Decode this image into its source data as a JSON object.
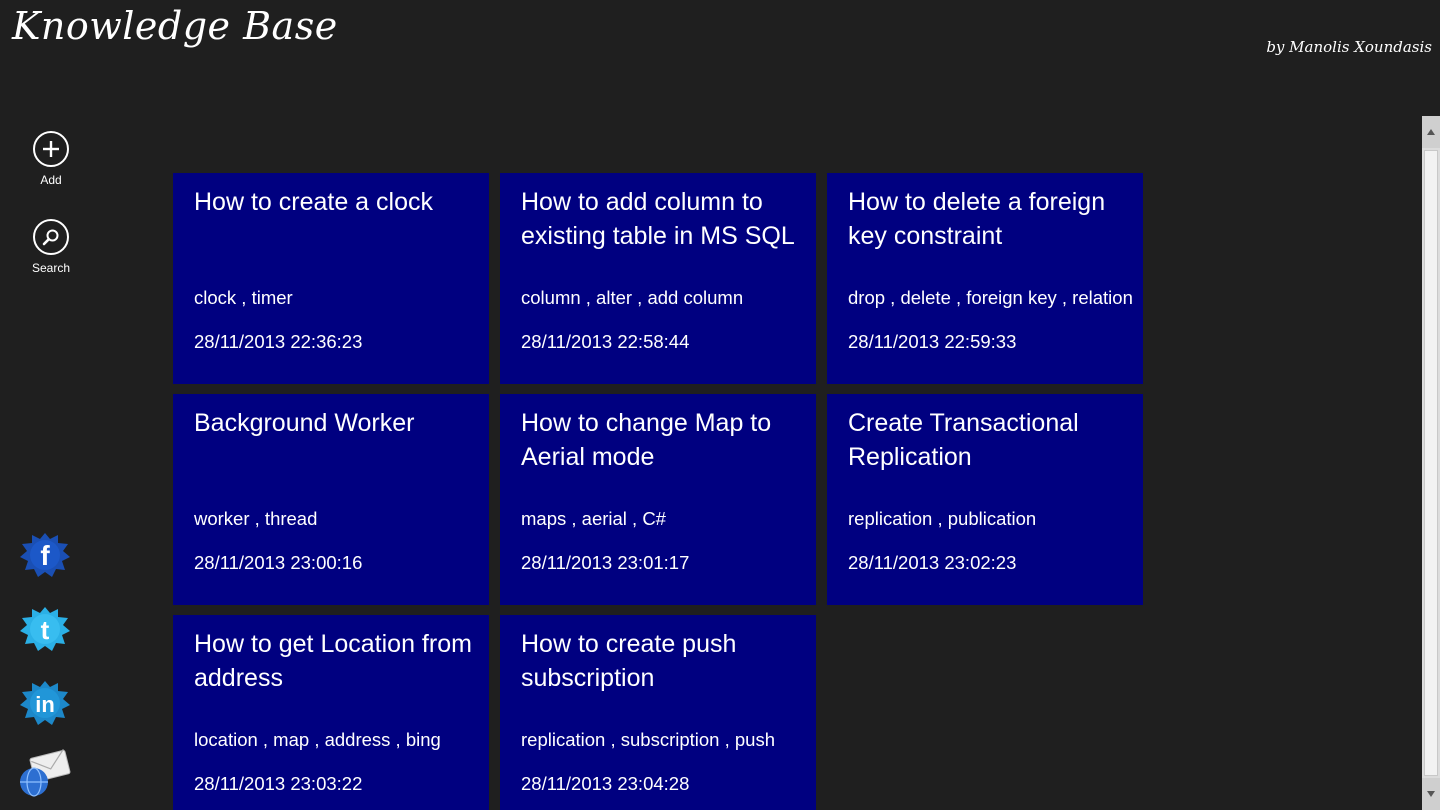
{
  "header": {
    "title": "Knowledge Base",
    "author": "by Manolis Xoundasis"
  },
  "actions": [
    {
      "label": "Add",
      "icon": "plus-circle-icon"
    },
    {
      "label": "Search",
      "icon": "magnifier-circle-icon"
    }
  ],
  "social": [
    {
      "icon": "facebook-icon",
      "letter": "f",
      "color": "#1a4fb4"
    },
    {
      "icon": "twitter-icon",
      "letter": "t",
      "color": "#2bb0e6"
    },
    {
      "icon": "linkedin-icon",
      "letter": "in",
      "color": "#1d88c9"
    },
    {
      "icon": "email-icon",
      "color": "#2d6fd1"
    }
  ],
  "colors": {
    "background": "#1f1f1f",
    "tile": "#000080",
    "text": "#ffffff"
  },
  "articles": [
    {
      "title": "How to create a clock",
      "tags": "clock , timer",
      "date": "28/11/2013 22:36:23"
    },
    {
      "title": "How to add column to existing table in MS SQL",
      "tags": "column , alter , add column",
      "date": "28/11/2013 22:58:44"
    },
    {
      "title": "How to delete a foreign key constraint",
      "tags": "drop , delete , foreign key , relation",
      "date": "28/11/2013 22:59:33"
    },
    {
      "title": "Background Worker",
      "tags": "worker , thread",
      "date": "28/11/2013 23:00:16"
    },
    {
      "title": "How to change Map to Aerial mode",
      "tags": "maps , aerial , C#",
      "date": "28/11/2013 23:01:17"
    },
    {
      "title": "Create Transactional Replication",
      "tags": "replication , publication",
      "date": "28/11/2013 23:02:23"
    },
    {
      "title": "How to get Location from address",
      "tags": "location , map , address , bing",
      "date": "28/11/2013 23:03:22"
    },
    {
      "title": "How to create push subscription",
      "tags": "replication , subscription , push",
      "date": "28/11/2013 23:04:28"
    }
  ]
}
